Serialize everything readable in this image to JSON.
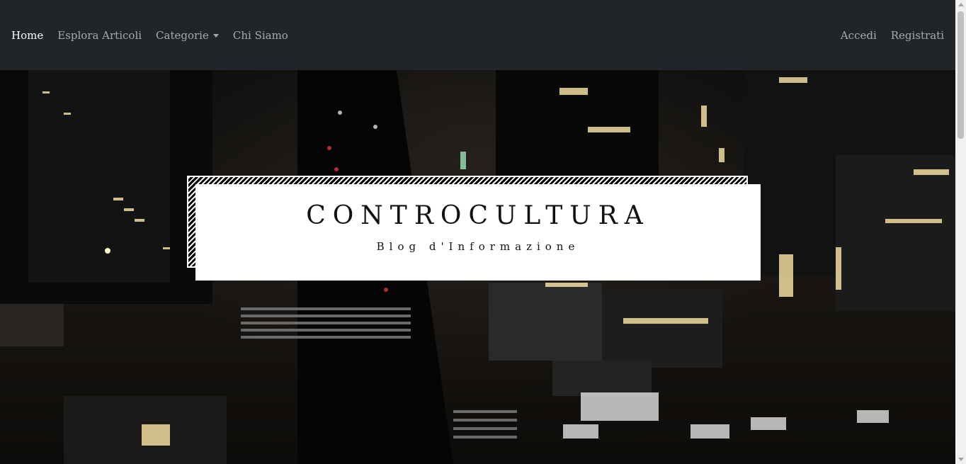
{
  "nav": {
    "left": [
      {
        "label": "Home",
        "active": true
      },
      {
        "label": "Esplora Articoli",
        "active": false
      },
      {
        "label": "Categorie",
        "active": false,
        "dropdown": true
      },
      {
        "label": "Chi Siamo",
        "active": false
      }
    ],
    "right": [
      {
        "label": "Accedi"
      },
      {
        "label": "Registrati"
      }
    ]
  },
  "hero": {
    "title": "CONTROCULTURA",
    "subtitle": "Blog d'Informazione"
  },
  "colors": {
    "navbar_bg": "#212529",
    "nav_link": "rgba(255,255,255,0.6)",
    "nav_active": "#ffffff"
  }
}
